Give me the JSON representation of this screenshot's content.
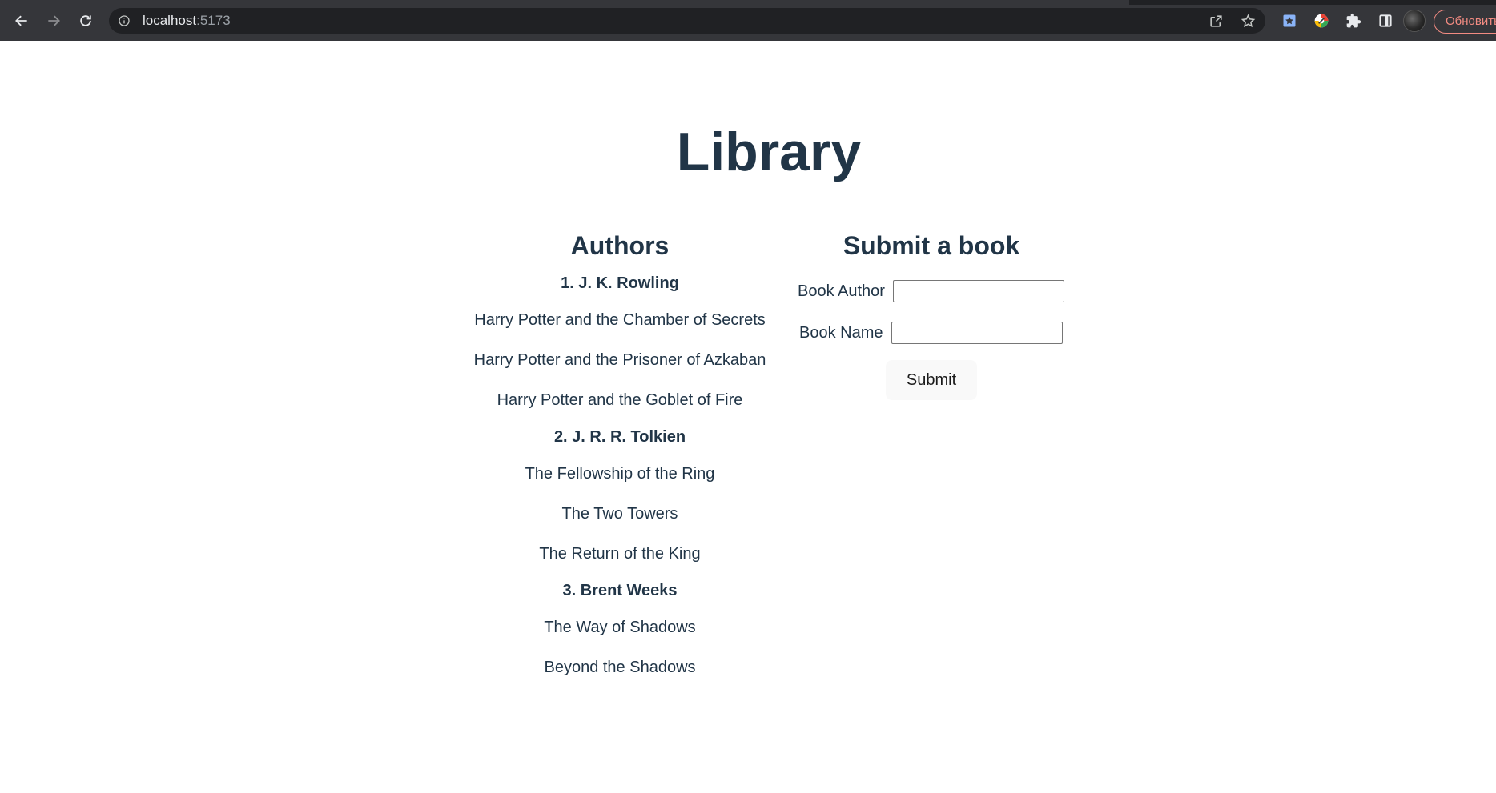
{
  "browser": {
    "url_host": "localhost",
    "url_port": ":5173",
    "update_label": "Обновить"
  },
  "page": {
    "title": "Library"
  },
  "authors": {
    "heading": "Authors",
    "list": [
      {
        "name": "1. J. K. Rowling",
        "books": [
          "Harry Potter and the Chamber of Secrets",
          "Harry Potter and the Prisoner of Azkaban",
          "Harry Potter and the Goblet of Fire"
        ]
      },
      {
        "name": "2. J. R. R. Tolkien",
        "books": [
          "The Fellowship of the Ring",
          "The Two Towers",
          "The Return of the King"
        ]
      },
      {
        "name": "3. Brent Weeks",
        "books": [
          "The Way of Shadows",
          "Beyond the Shadows"
        ]
      }
    ]
  },
  "submit_form": {
    "heading": "Submit a book",
    "author_label": "Book Author",
    "author_value": "",
    "name_label": "Book Name",
    "name_value": "",
    "submit_label": "Submit"
  },
  "colors": {
    "text": "#213547",
    "chrome_bg": "#35363a",
    "omnibox_bg": "#202124",
    "update_accent": "#f28b82"
  }
}
